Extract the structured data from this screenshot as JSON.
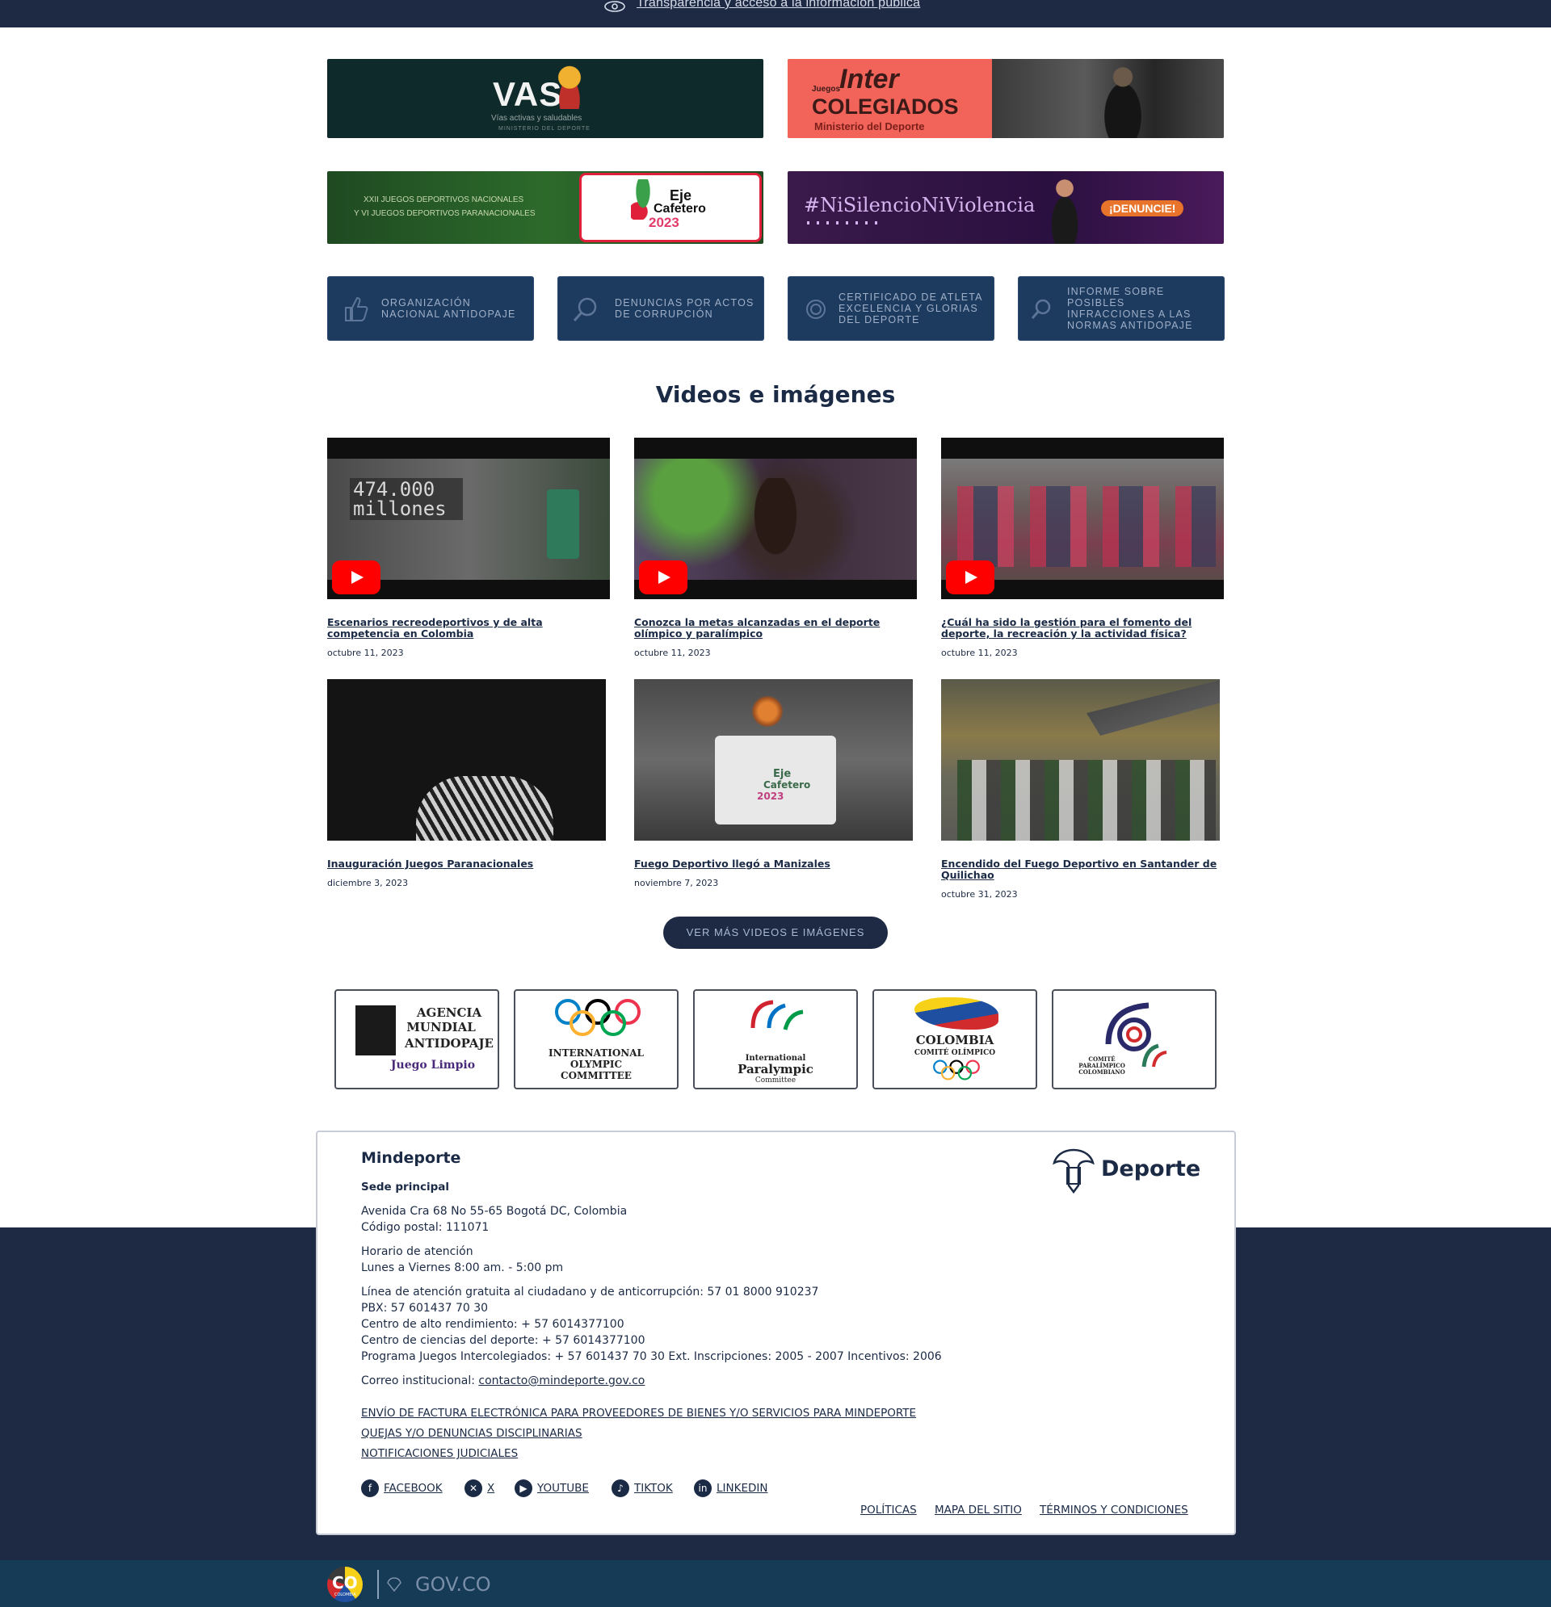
{
  "topbar": {
    "transparency_link": "Transparencia y acceso a la información pública",
    "eye_icon": "eye-icon"
  },
  "banners": {
    "vas": {
      "title": "VAS",
      "subtitle": "Vías activas y saludables",
      "ministry": "MINISTERIO DEL DEPORTE"
    },
    "intercolegiados": {
      "small": "Juegos",
      "inter": "Inter",
      "colegiados": "COLEGIADOS",
      "ministry": "Ministerio del Deporte"
    },
    "juegos_nacionales": {
      "line1": "XXII JUEGOS DEPORTIVOS NACIONALES",
      "line2": "Y VI JUEGOS DEPORTIVOS PARANACIONALES",
      "logo1": "Eje",
      "logo2": "Cafetero",
      "logo3": "2023"
    },
    "ni_silencio": {
      "hashtag": "#NiSilencioNiViolencia",
      "button": "¡DENUNCIE!"
    }
  },
  "quick_links": [
    {
      "label": "ORGANIZACIÓN NACIONAL ANTIDOPAJE",
      "icon": "thumbs-up-icon"
    },
    {
      "label": "DENUNCIAS POR ACTOS DE CORRUPCIÓN",
      "icon": "search-icon"
    },
    {
      "label": "CERTIFICADO DE ATLETA EXCELENCIA Y GLORIAS DEL DEPORTE",
      "icon": "medal-icon"
    },
    {
      "label": "INFORME SOBRE POSIBLES INFRACCIONES A LAS NORMAS ANTIDOPAJE",
      "icon": "search-icon"
    }
  ],
  "section_title": "Videos e imágenes",
  "videos": [
    {
      "title": "Escenarios recreodeportivos y de alta competencia en Colombia",
      "date": "octubre 11, 2023",
      "overlay": "474.000 millones"
    },
    {
      "title": "Conozca la metas alcanzadas en el deporte olímpico y paralímpico",
      "date": "octubre 11, 2023"
    },
    {
      "title": "¿Cuál ha sido la gestión para el fomento del deporte, la recreación y la actividad física?",
      "date": "octubre 11, 2023"
    }
  ],
  "images": [
    {
      "title": "Inauguración Juegos Paranacionales",
      "date": "diciembre 3, 2023"
    },
    {
      "title": "Fuego Deportivo llegó a Manizales",
      "date": "noviembre 7, 2023",
      "logo1": "Eje",
      "logo2": "Cafetero",
      "logo3": "2023"
    },
    {
      "title": "Encendido del Fuego Deportivo en Santander de Quilichao",
      "date": "octubre 31, 2023"
    }
  ],
  "more_button": "VER MÁS VIDEOS E IMÁGENES",
  "partners": [
    {
      "l1": "AGENCIA",
      "l2": "MUNDIAL",
      "l3": "ANTIDOPAJE",
      "l4": "Juego Limpio"
    },
    {
      "l1": "INTERNATIONAL",
      "l2": "OLYMPIC",
      "l3": "COMMITTEE"
    },
    {
      "l1": "International",
      "l2": "Paralympic",
      "l3": "Committee"
    },
    {
      "l1": "COLOMBIA",
      "l2": "COMITÉ OLÍMPICO"
    },
    {
      "l1": "COMITÉ",
      "l2": "PARALÍMPICO",
      "l3": "COLOMBIANO"
    }
  ],
  "footer": {
    "org": "Mindeporte",
    "sede": "Sede principal",
    "address": "Avenida Cra 68 No 55-65 Bogotá DC, Colombia",
    "postal": "Código postal: 111071",
    "hours_label": "Horario de atención",
    "hours": "Lunes a Viernes 8:00 am. - 5:00 pm",
    "line1": "Línea de atención gratuita al ciudadano y de anticorrupción: 57 01 8000 910237",
    "pbx": "PBX: 57 601437 70 30",
    "alto": "Centro de alto rendimiento: + 57 6014377100",
    "ciencias": "Centro de ciencias del deporte: + 57 6014377100",
    "programa": "Programa Juegos Intercolegiados: + 57 601437 70 30 Ext. Inscripciones: 2005 - 2007 Incentivos: 2006",
    "email_label": "Correo institucional:",
    "email": "contacto@mindeporte.gov.co",
    "links": [
      "ENVÍO DE FACTURA ELECTRÓNICA PARA PROVEEDORES DE BIENES Y/O SERVICIOS PARA MINDEPORTE",
      "QUEJAS Y/O DENUNCIAS DISCIPLINARIAS",
      "NOTIFICACIONES JUDICIALES"
    ],
    "social": [
      "FACEBOOK",
      "X",
      "YOUTUBE",
      "TIKTOK",
      "LINKEDIN"
    ],
    "legal": [
      "POLÍTICAS",
      "MAPA DEL SITIO",
      "TÉRMINOS Y CONDICIONES"
    ],
    "logo_text": "Deporte"
  },
  "govbar": {
    "co": "CO",
    "colombia": "COLOMBIA",
    "gov": "GOV.CO"
  },
  "colors": {
    "navy": "#1e2a44",
    "quick": "#1d3a5f",
    "gov": "#163b57"
  }
}
